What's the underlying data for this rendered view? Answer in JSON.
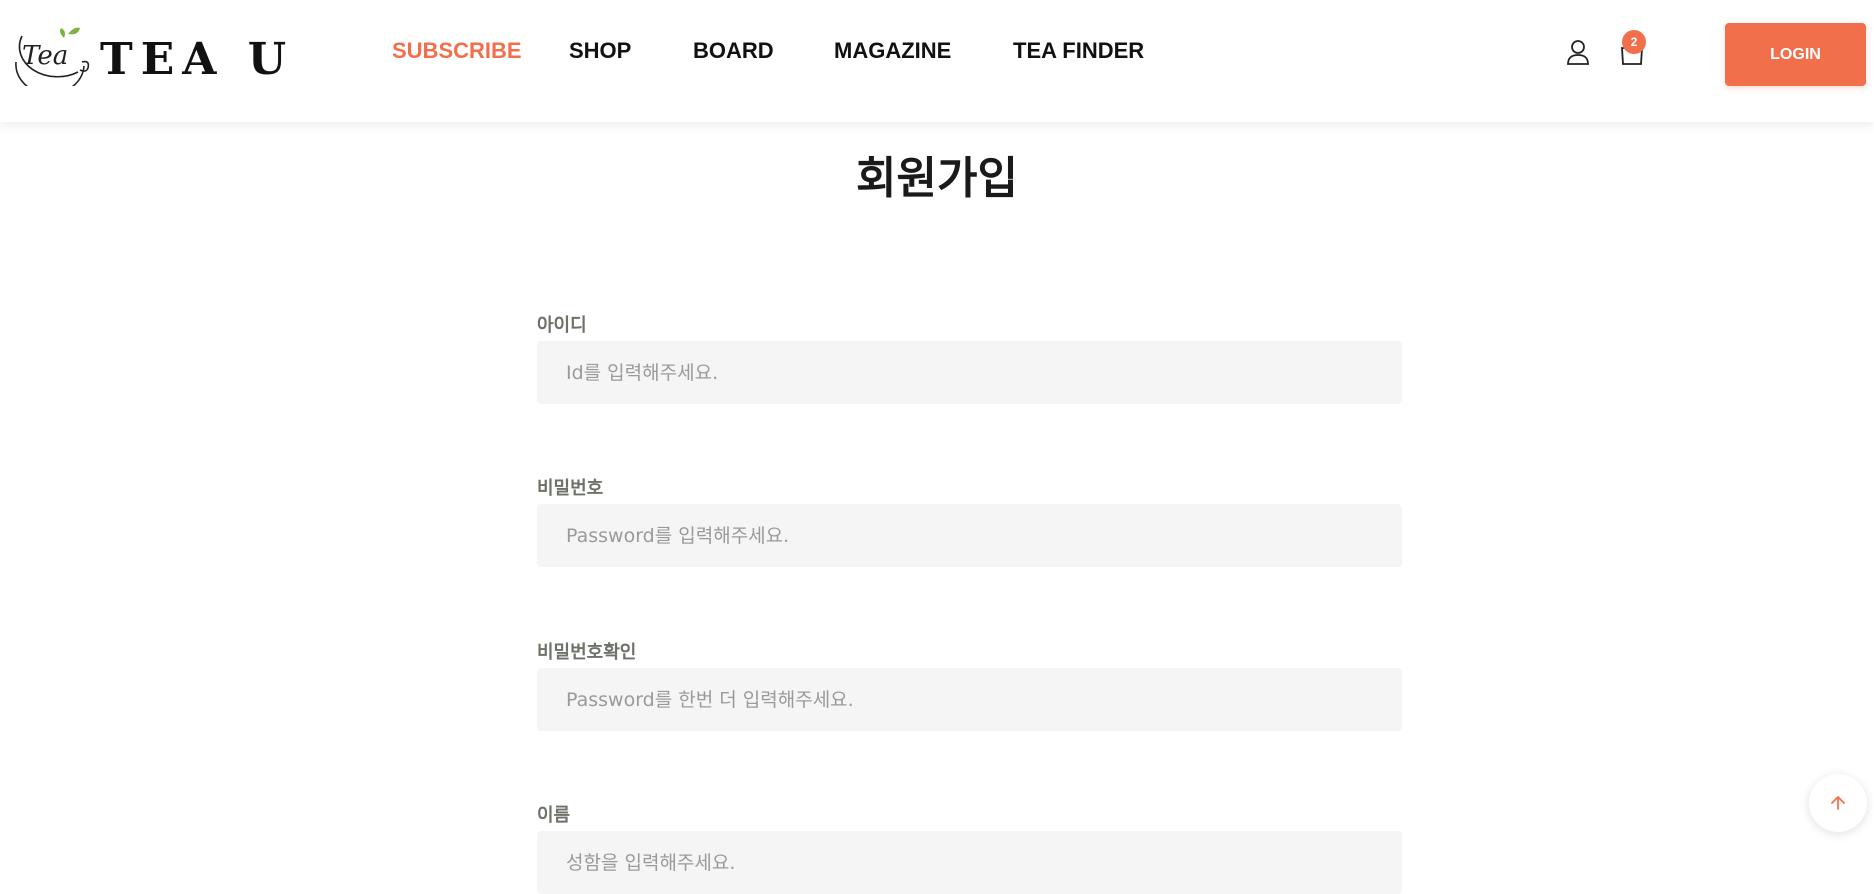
{
  "brand": {
    "logo_script": "Tea",
    "name": "TEA U"
  },
  "nav": [
    {
      "label": "SUBSCRIBE",
      "active": true
    },
    {
      "label": "SHOP",
      "active": false
    },
    {
      "label": "BOARD",
      "active": false
    },
    {
      "label": "MAGAZINE",
      "active": false
    },
    {
      "label": "TEA FINDER",
      "active": false
    }
  ],
  "header_icons": {
    "user": "user-icon",
    "cart": "shopping-bag-icon",
    "cart_count": "2"
  },
  "login_label": "LOGIN",
  "page_title": "회원가입",
  "form": {
    "fields": [
      {
        "label": "아이디",
        "placeholder": "Id를 입력해주세요.",
        "value": ""
      },
      {
        "label": "비밀번호",
        "placeholder": "Password를 입력해주세요.",
        "value": ""
      },
      {
        "label": "비밀번호확인",
        "placeholder": "Password를 한번 더 입력해주세요.",
        "value": ""
      },
      {
        "label": "이름",
        "placeholder": "성함을 입력해주세요.",
        "value": ""
      }
    ]
  },
  "scroll_top_icon": "arrow-up-icon",
  "colors": {
    "accent": "#f26f4c",
    "label": "#6d7268",
    "input_bg": "#f5f5f5",
    "logo_leaf": "#7cb342"
  }
}
